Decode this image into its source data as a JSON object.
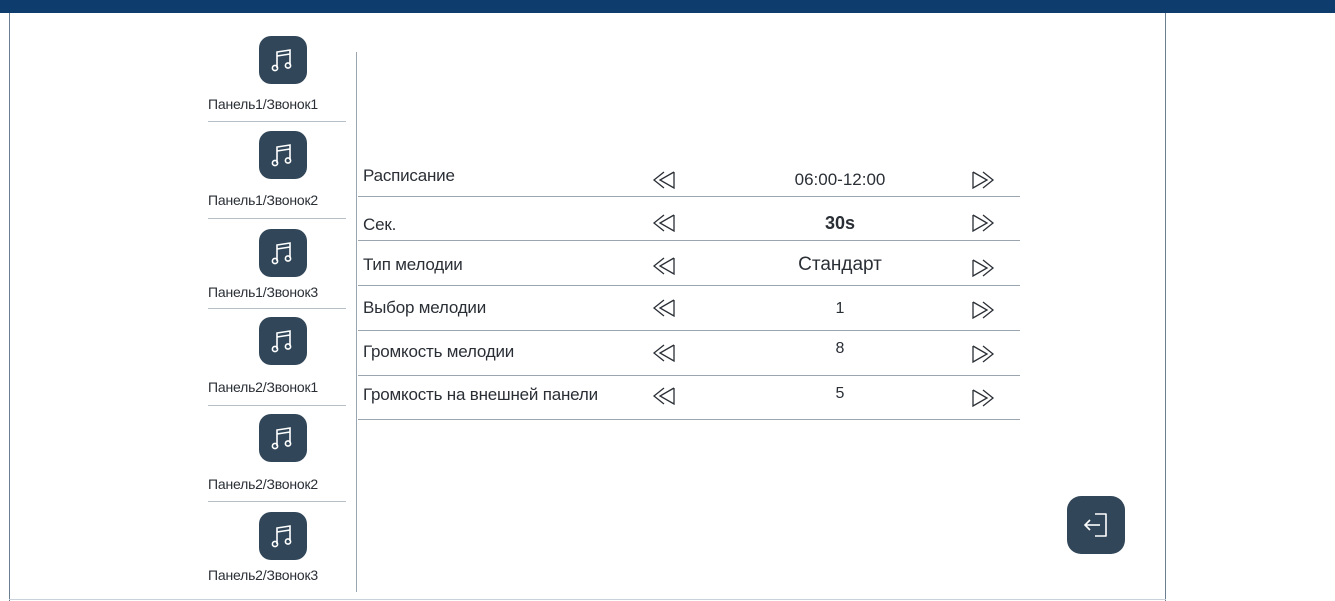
{
  "sidebar": {
    "items": [
      {
        "label": "Панель1/Звонок1",
        "icon": "music-note-icon"
      },
      {
        "label": "Панель1/Звонок2",
        "icon": "music-note-icon"
      },
      {
        "label": "Панель1/Звонок3",
        "icon": "music-note-icon"
      },
      {
        "label": "Панель2/Звонок1",
        "icon": "music-note-icon"
      },
      {
        "label": "Панель2/Звонок2",
        "icon": "music-note-icon"
      },
      {
        "label": "Панель2/Звонок3",
        "icon": "music-note-icon"
      }
    ]
  },
  "settings": {
    "rows": [
      {
        "label": "Расписание",
        "value": "06:00-12:00"
      },
      {
        "label": "Сек.",
        "value": "30s"
      },
      {
        "label": "Тип мелодии",
        "value": "Стандарт"
      },
      {
        "label": "Выбор мелодии",
        "value": "1"
      },
      {
        "label": "Громкость мелодии",
        "value": "8"
      },
      {
        "label": "Громкость на внешней панели",
        "value": "5"
      }
    ],
    "prev_icon": "double-chevron-left-icon",
    "next_icon": "double-chevron-right-icon"
  },
  "exit_button": {
    "icon": "exit-icon"
  },
  "colors": {
    "header": "#0e3d6d",
    "icon_tile": "#314759",
    "text": "#2a2f36",
    "divider": "#9aa5b0"
  }
}
